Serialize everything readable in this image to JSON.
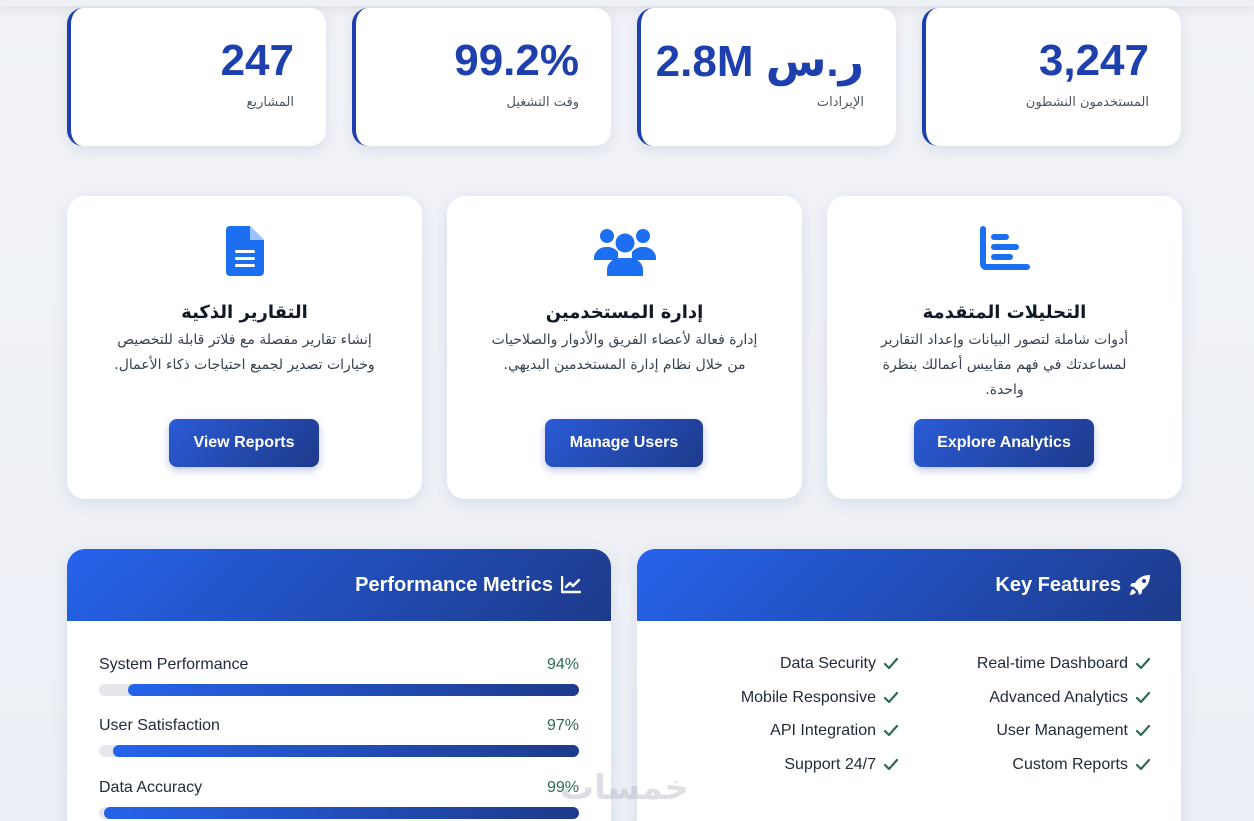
{
  "stats": [
    {
      "value": "247",
      "label": "المشاريع"
    },
    {
      "value": "99.2%",
      "label": "وقت التشغيل"
    },
    {
      "value": "2.8M ر.س",
      "label": "الإيرادات"
    },
    {
      "value": "3,247",
      "label": "المستخدمون النشطون"
    }
  ],
  "features": [
    {
      "icon": "document-icon",
      "title": "التقارير الذكية",
      "description": "إنشاء تقارير مفصلة مع فلاتر قابلة للتخصيص وخيارات تصدير لجميع احتياجات ذكاء الأعمال.",
      "button": "View Reports"
    },
    {
      "icon": "users-icon",
      "title": "إدارة المستخدمين",
      "description": "إدارة فعالة لأعضاء الفريق والأدوار والصلاحيات من خلال نظام إدارة المستخدمين البديهي.",
      "button": "Manage Users"
    },
    {
      "icon": "bar-chart-icon",
      "title": "التحليلات المتقدمة",
      "description": "أدوات شاملة لتصور البيانات وإعداد التقارير لمساعدتك في فهم مقاييس أعمالك بنظرة واحدة.",
      "button": "Explore Analytics"
    }
  ],
  "performance": {
    "title": "Performance Metrics",
    "icon": "line-chart-icon",
    "metrics": [
      {
        "name": "System Performance",
        "value_label": "94%",
        "value": 94
      },
      {
        "name": "User Satisfaction",
        "value_label": "97%",
        "value": 97
      },
      {
        "name": "Data Accuracy",
        "value_label": "99%",
        "value": 99
      }
    ]
  },
  "key_features": {
    "title": "Key Features",
    "icon": "rocket-icon",
    "left_column": [
      "Data Security",
      "Mobile Responsive",
      "API Integration",
      "Support 24/7"
    ],
    "right_column": [
      "Real-time Dashboard",
      "Advanced Analytics",
      "User Management",
      "Custom Reports"
    ]
  },
  "watermark": "خمسات",
  "colors": {
    "primary": "#1e40af",
    "accent": "#2563eb",
    "check": "#2d6a4f"
  }
}
